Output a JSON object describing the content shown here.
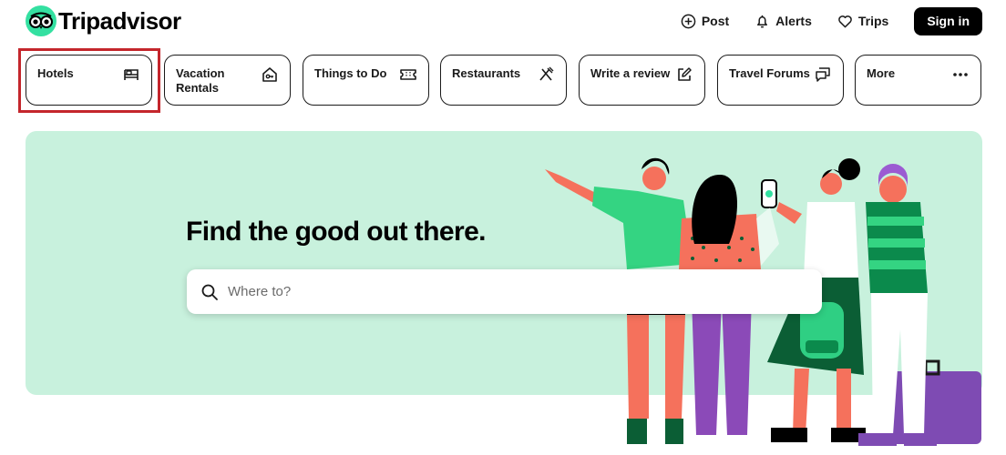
{
  "brand": {
    "name": "Tripadvisor",
    "logo_color": "#34e0a1",
    "logo_icon": "owl-logo-icon"
  },
  "header": {
    "post_label": "Post",
    "alerts_label": "Alerts",
    "trips_label": "Trips",
    "signin_label": "Sign in",
    "icons": [
      "plus-circle-icon",
      "bell-icon",
      "heart-icon"
    ]
  },
  "categories": [
    {
      "label": "Hotels",
      "icon": "bed-icon",
      "selected": true
    },
    {
      "label": "Vacation Rentals",
      "icon": "house-key-icon"
    },
    {
      "label": "Things to Do",
      "icon": "ticket-icon"
    },
    {
      "label": "Restaurants",
      "icon": "fork-knife-icon"
    },
    {
      "label": "Write a review",
      "icon": "edit-icon"
    },
    {
      "label": "Travel Forums",
      "icon": "chat-icon"
    },
    {
      "label": "More",
      "icon": "more-dots-icon"
    }
  ],
  "hero": {
    "title": "Find the good out there.",
    "background": "#c8f1dd",
    "search_placeholder": "Where to?"
  },
  "colors": {
    "accent": "#34e0a1",
    "highlight": "#c4262c",
    "button_dark": "#000000"
  }
}
